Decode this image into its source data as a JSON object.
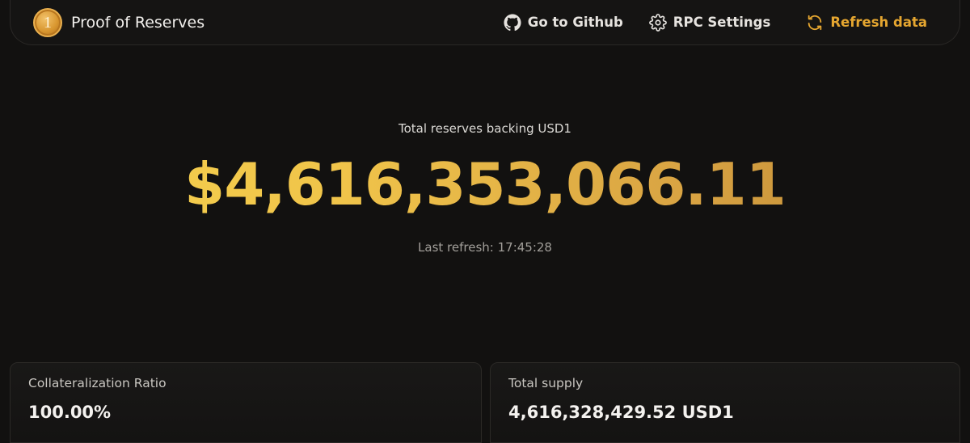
{
  "header": {
    "brand_icon_glyph": "1",
    "title": "Proof of Reserves",
    "github_label": "Go to Github",
    "rpc_label": "RPC Settings",
    "refresh_label": "Refresh data",
    "accent_color": "#e5a630"
  },
  "hero": {
    "label": "Total reserves backing USD1",
    "amount": "$4,616,353,066.11",
    "last_refresh": "Last refresh: 17:45:28"
  },
  "stats": {
    "collateral_label": "Collateralization Ratio",
    "collateral_value": "100.00%",
    "supply_label": "Total supply",
    "supply_value": "4,616,328,429.52 USD1"
  },
  "icons": [
    "coin-logo-icon",
    "github-icon",
    "gear-icon",
    "refresh-icon"
  ]
}
